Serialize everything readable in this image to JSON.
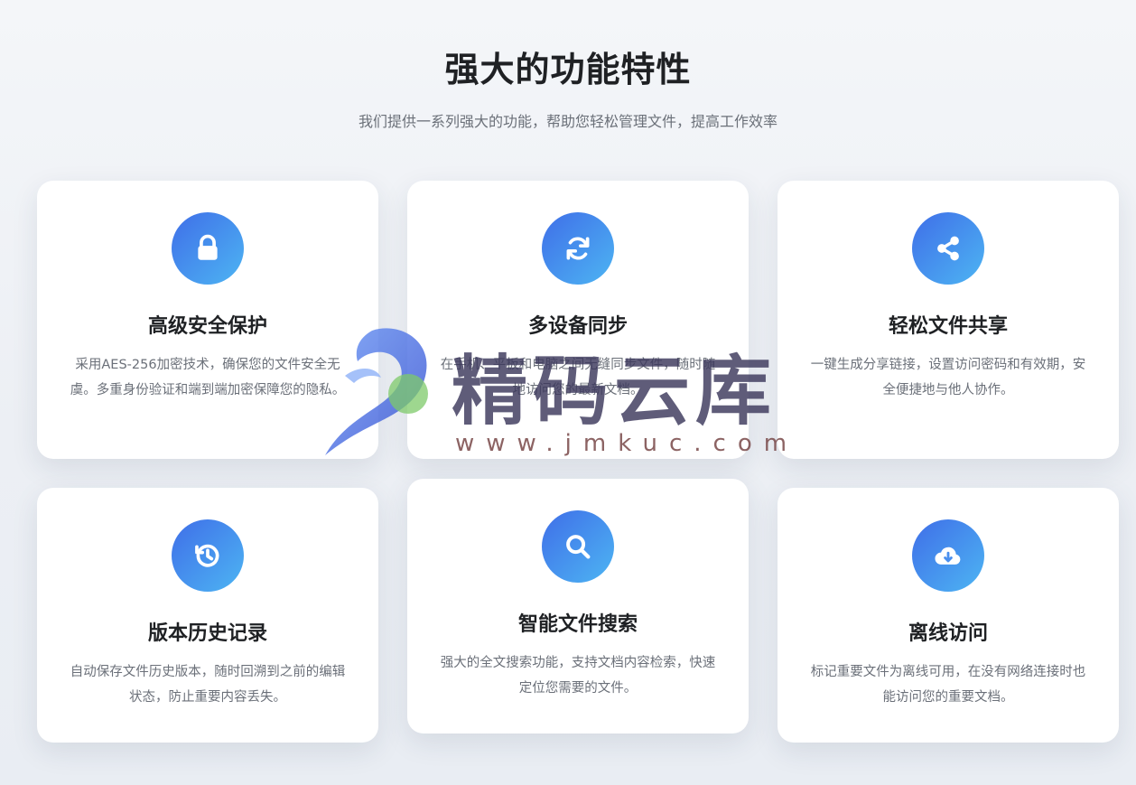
{
  "section": {
    "title": "强大的功能特性",
    "subtitle": "我们提供一系列强大的功能，帮助您轻松管理文件，提高工作效率"
  },
  "features": [
    {
      "icon": "lock-icon",
      "title": "高级安全保护",
      "desc": "采用AES-256加密技术，确保您的文件安全无虞。多重身份验证和端到端加密保障您的隐私。"
    },
    {
      "icon": "sync-icon",
      "title": "多设备同步",
      "desc": "在手机、平板和电脑之间无缝同步文件，随时随地访问您的最新文档。"
    },
    {
      "icon": "share-icon",
      "title": "轻松文件共享",
      "desc": "一键生成分享链接，设置访问密码和有效期，安全便捷地与他人协作。"
    },
    {
      "icon": "history-icon",
      "title": "版本历史记录",
      "desc": "自动保存文件历史版本，随时回溯到之前的编辑状态，防止重要内容丢失。"
    },
    {
      "icon": "search-icon",
      "title": "智能文件搜索",
      "desc": "强大的全文搜索功能，支持文档内容检索，快速定位您需要的文件。"
    },
    {
      "icon": "cloud-download-icon",
      "title": "离线访问",
      "desc": "标记重要文件为离线可用，在没有网络连接时也能访问您的重要文档。"
    }
  ],
  "watermark": {
    "text": "精码云库",
    "url": "www.jmkuc.com"
  },
  "colors": {
    "icon_gradient_start": "#3f6ee8",
    "icon_gradient_end": "#4db5f3",
    "title": "#1f2124",
    "body_text": "#6b7079",
    "card_bg": "#ffffff"
  }
}
